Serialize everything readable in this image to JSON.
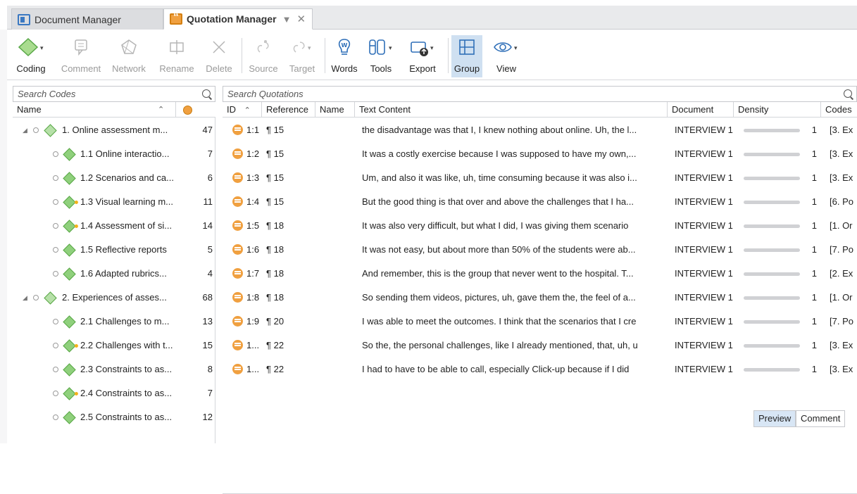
{
  "tabs": [
    {
      "label": "Document Manager"
    },
    {
      "label": "Quotation Manager"
    }
  ],
  "toolbar": {
    "coding": "Coding",
    "comment": "Comment",
    "network": "Network",
    "rename": "Rename",
    "delete": "Delete",
    "source": "Source",
    "target": "Target",
    "words": "Words",
    "tools": "Tools",
    "export": "Export",
    "group": "Group",
    "view": "View"
  },
  "codes": {
    "search_placeholder": "Search Codes",
    "col_name": "Name",
    "items": [
      {
        "label": "1. Online assessment m...",
        "count": "47",
        "group": true
      },
      {
        "label": "1.1 Online interactio...",
        "count": "7",
        "group": false,
        "dot": false
      },
      {
        "label": "1.2 Scenarios and ca...",
        "count": "6",
        "group": false,
        "dot": false
      },
      {
        "label": "1.3 Visual learning m...",
        "count": "11",
        "group": false,
        "dot": true
      },
      {
        "label": "1.4 Assessment of si...",
        "count": "14",
        "group": false,
        "dot": true
      },
      {
        "label": "1.5 Reflective reports",
        "count": "5",
        "group": false,
        "dot": false
      },
      {
        "label": "1.6 Adapted rubrics...",
        "count": "4",
        "group": false,
        "dot": false
      },
      {
        "label": "2. Experiences of asses...",
        "count": "68",
        "group": true
      },
      {
        "label": "2.1 Challenges to m...",
        "count": "13",
        "group": false,
        "dot": false
      },
      {
        "label": "2.2 Challenges with t...",
        "count": "15",
        "group": false,
        "dot": true
      },
      {
        "label": "2.3 Constraints to as...",
        "count": "8",
        "group": false,
        "dot": false
      },
      {
        "label": "2.4 Constraints to as...",
        "count": "7",
        "group": false,
        "dot": true
      },
      {
        "label": "2.5 Constraints to as...",
        "count": "12",
        "group": false,
        "dot": false
      }
    ]
  },
  "quotations": {
    "search_placeholder": "Search Quotations",
    "columns": {
      "id": "ID",
      "reference": "Reference",
      "name": "Name",
      "text": "Text Content",
      "document": "Document",
      "density": "Density",
      "codes": "Codes"
    },
    "rows": [
      {
        "id": "1:1",
        "ref": "¶ 15",
        "text": "the disadvantage was that I, I knew nothing about online. Uh, the l...",
        "doc": "INTERVIEW 1",
        "density": "1",
        "codes": "[3. Ex"
      },
      {
        "id": "1:2",
        "ref": "¶ 15",
        "text": "It was a costly exercise because I was supposed to have my own,...",
        "doc": "INTERVIEW 1",
        "density": "1",
        "codes": "[3. Ex"
      },
      {
        "id": "1:3",
        "ref": "¶ 15",
        "text": "Um, and also it was like, uh, time consuming because it was also i...",
        "doc": "INTERVIEW 1",
        "density": "1",
        "codes": "[3. Ex"
      },
      {
        "id": "1:4",
        "ref": "¶ 15",
        "text": "But the good thing is that over and above the challenges that I ha...",
        "doc": "INTERVIEW 1",
        "density": "1",
        "codes": "[6. Po"
      },
      {
        "id": "1:5",
        "ref": "¶ 18",
        "text": "It was also very difficult, but what I did, I was giving them scenario",
        "doc": "INTERVIEW 1",
        "density": "1",
        "codes": "[1. Or"
      },
      {
        "id": "1:6",
        "ref": "¶ 18",
        "text": "It was not easy, but about more than 50% of the students were ab...",
        "doc": "INTERVIEW 1",
        "density": "1",
        "codes": "[7. Po"
      },
      {
        "id": "1:7",
        "ref": "¶ 18",
        "text": "And remember, this is the group that never went to the hospital. T...",
        "doc": "INTERVIEW 1",
        "density": "1",
        "codes": "[2. Ex"
      },
      {
        "id": "1:8",
        "ref": "¶ 18",
        "text": "So sending them videos, pictures, uh, gave them the, the feel of a...",
        "doc": "INTERVIEW 1",
        "density": "1",
        "codes": "[1. Or"
      },
      {
        "id": "1:9",
        "ref": "¶ 20",
        "text": "I was able to meet the outcomes. I think that the scenarios that I cre",
        "doc": "INTERVIEW 1",
        "density": "1",
        "codes": "[7. Po"
      },
      {
        "id": "1...",
        "ref": "¶ 22",
        "text": "So the, the personal challenges, like I already mentioned, that, uh, u",
        "doc": "INTERVIEW 1",
        "density": "1",
        "codes": "[3. Ex"
      },
      {
        "id": "1...",
        "ref": "¶ 22",
        "text": "I had to have to be able to call, especially Click-up because if I did",
        "doc": "INTERVIEW 1",
        "density": "1",
        "codes": "[3. Ex"
      }
    ]
  },
  "bottom": {
    "preview": "Preview",
    "comment": "Comment"
  },
  "colors": {
    "accent": "#3a78c2",
    "code_green": "#8fd07c",
    "quote_orange": "#f0a040",
    "selected_bg": "#cfe0f1"
  }
}
